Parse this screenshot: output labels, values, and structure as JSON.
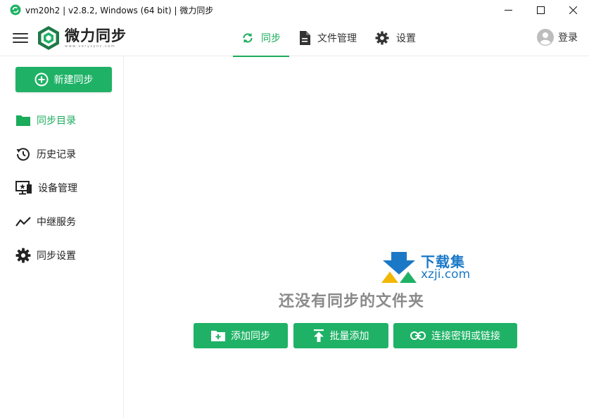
{
  "window": {
    "title": "vm20h2 | v2.8.2, Windows (64 bit) | 微力同步",
    "controls": {
      "minimize": "—",
      "maximize": "☐",
      "close": "✕"
    }
  },
  "header": {
    "logo_name": "微力同步",
    "logo_url": "www.verysync.com",
    "tabs": [
      {
        "label": "同步",
        "icon": "sync-icon",
        "active": true
      },
      {
        "label": "文件管理",
        "icon": "document-icon",
        "active": false
      },
      {
        "label": "设置",
        "icon": "gear-icon",
        "active": false
      }
    ],
    "login_label": "登录"
  },
  "sidebar": {
    "new_sync_label": "新建同步",
    "items": [
      {
        "label": "同步目录",
        "icon": "folder-icon",
        "active": true
      },
      {
        "label": "历史记录",
        "icon": "history-icon",
        "active": false
      },
      {
        "label": "设备管理",
        "icon": "device-icon",
        "active": false
      },
      {
        "label": "中继服务",
        "icon": "relay-icon",
        "active": false
      },
      {
        "label": "同步设置",
        "icon": "gear-icon",
        "active": false
      }
    ]
  },
  "main": {
    "empty_message": "还没有同步的文件夹",
    "actions": [
      {
        "label": "添加同步",
        "icon": "folder-add-icon"
      },
      {
        "label": "批量添加",
        "icon": "upload-icon"
      },
      {
        "label": "连接密钥或链接",
        "icon": "link-icon"
      }
    ]
  },
  "watermark": {
    "title": "下载集",
    "url": "xzji.com"
  },
  "colors": {
    "accent": "#1fb266",
    "accent_text": "#1aab5b",
    "watermark": "#1b78c7"
  }
}
